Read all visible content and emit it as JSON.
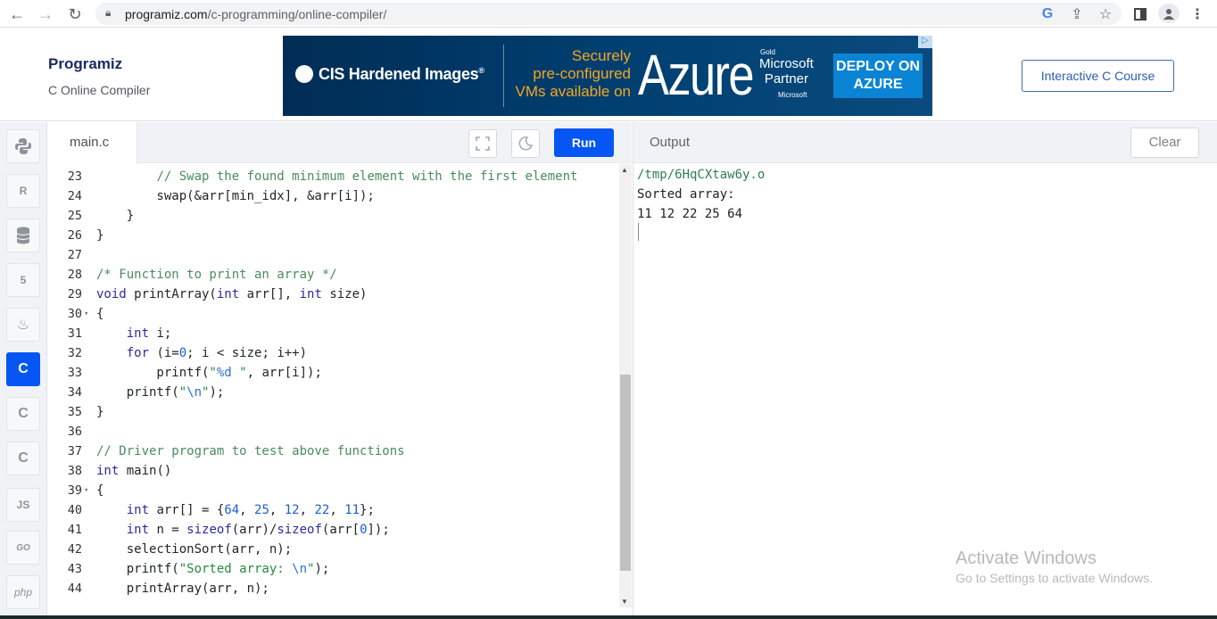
{
  "browser": {
    "url_host": "programiz.com",
    "url_path": "/c-programming/online-compiler/",
    "icons": [
      "back-icon",
      "forward-icon",
      "reload-icon",
      "lock-icon",
      "google-icon",
      "share-icon",
      "star-icon",
      "sidepanel-icon",
      "profile-icon",
      "menu-icon"
    ]
  },
  "header": {
    "logo": "Programiz",
    "subtitle": "C Online Compiler",
    "course_button": "Interactive C Course"
  },
  "ad": {
    "cis": "CIS Hardened Images",
    "reg": "®",
    "secure_line1": "Securely",
    "secure_line2": "pre-configured",
    "secure_line3": "VMs available on",
    "azure": "Azure",
    "gold": "Gold",
    "ms_partner_1": "Microsoft",
    "ms_partner_2": "Partner",
    "ms_small": "Microsoft",
    "deploy_1": "DEPLOY ON",
    "deploy_2": "AZURE",
    "adchoices": "▷"
  },
  "sidebar": {
    "items": [
      {
        "name": "python",
        "label": "Py"
      },
      {
        "name": "r",
        "label": "R"
      },
      {
        "name": "sql",
        "label": "≡"
      },
      {
        "name": "html",
        "label": "5"
      },
      {
        "name": "java",
        "label": "♨"
      },
      {
        "name": "c",
        "label": "C"
      },
      {
        "name": "cpp",
        "label": "C"
      },
      {
        "name": "csharp",
        "label": "C"
      },
      {
        "name": "javascript",
        "label": "JS"
      },
      {
        "name": "go",
        "label": "GO"
      },
      {
        "name": "php",
        "label": "php"
      }
    ]
  },
  "editor": {
    "tab": "main.c",
    "run_label": "Run",
    "lines": [
      {
        "n": "23",
        "fold": "",
        "html": "        <span class='cm'>// Swap the found minimum element with the first element</span>"
      },
      {
        "n": "24",
        "fold": "",
        "html": "        swap(&amp;arr[min_idx], &amp;arr[i]);"
      },
      {
        "n": "25",
        "fold": "",
        "html": "    }"
      },
      {
        "n": "26",
        "fold": "",
        "html": "}"
      },
      {
        "n": "27",
        "fold": "",
        "html": ""
      },
      {
        "n": "28",
        "fold": "",
        "html": "<span class='cm'>/* Function to print an array */</span>"
      },
      {
        "n": "29",
        "fold": "",
        "html": "<span class='kw'>void</span> printArray(<span class='kw'>int</span> arr[], <span class='kw'>int</span> size)"
      },
      {
        "n": "30",
        "fold": "▾",
        "html": "{"
      },
      {
        "n": "31",
        "fold": "",
        "html": "    <span class='kw'>int</span> i;"
      },
      {
        "n": "32",
        "fold": "",
        "html": "    <span class='kw'>for</span> (i=<span class='num'>0</span>; i &lt; size; i++)"
      },
      {
        "n": "33",
        "fold": "",
        "html": "        printf(<span class='str'>\"</span><span class='esc'>%d</span><span class='str'> \"</span>, arr[i]);"
      },
      {
        "n": "34",
        "fold": "",
        "html": "    printf(<span class='str'>\"</span><span class='esc'>\\n</span><span class='str'>\"</span>);"
      },
      {
        "n": "35",
        "fold": "",
        "html": "}"
      },
      {
        "n": "36",
        "fold": "",
        "html": ""
      },
      {
        "n": "37",
        "fold": "",
        "html": "<span class='cm'>// Driver program to test above functions</span>"
      },
      {
        "n": "38",
        "fold": "",
        "html": "<span class='kw'>int</span> main()"
      },
      {
        "n": "39",
        "fold": "▾",
        "html": "{"
      },
      {
        "n": "40",
        "fold": "",
        "html": "    <span class='kw'>int</span> arr[] = {<span class='num'>64</span>, <span class='num'>25</span>, <span class='num'>12</span>, <span class='num'>22</span>, <span class='num'>11</span>};"
      },
      {
        "n": "41",
        "fold": "",
        "html": "    <span class='kw'>int</span> n = <span class='kw'>sizeof</span>(arr)/<span class='kw'>sizeof</span>(arr[<span class='num'>0</span>]);"
      },
      {
        "n": "42",
        "fold": "",
        "html": "    selectionSort(arr, n);"
      },
      {
        "n": "43",
        "fold": "",
        "html": "    printf(<span class='str'>\"Sorted array: </span><span class='esc'>\\n</span><span class='str'>\"</span>);"
      },
      {
        "n": "44",
        "fold": "",
        "html": "    printArray(arr, n);"
      }
    ]
  },
  "output": {
    "label": "Output",
    "clear_label": "Clear",
    "path_line": "/tmp/6HqCXtaw6y.o",
    "line2": "Sorted array:",
    "line3": "11 12 22 25 64"
  },
  "watermark": {
    "title": "Activate Windows",
    "text": "Go to Settings to activate Windows."
  }
}
